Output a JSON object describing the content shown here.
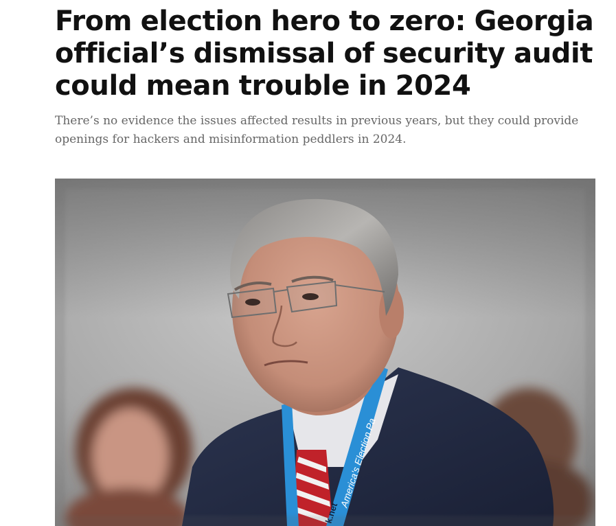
{
  "article": {
    "headline": "From election hero to zero: Georgia official’s dismissal of security audit could mean trouble in 2024",
    "dek": "There’s no evidence the issues affected results in previous years, but they could provide openings for hackers and misinformation peddlers in 2024."
  },
  "hero_image": {
    "lanyard_text_1": "America's Election Pa",
    "lanyard_text_2": "k.net"
  }
}
